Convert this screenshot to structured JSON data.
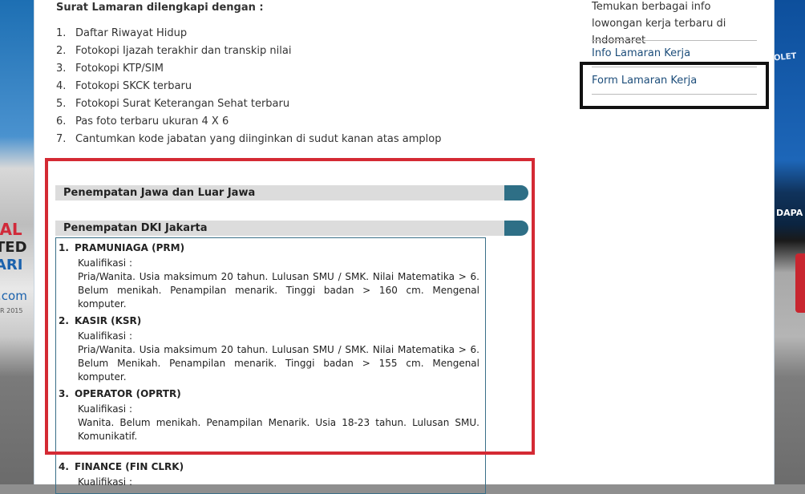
{
  "background": {
    "left_lines": [
      "IAL",
      "TED",
      "ARI",
      ".com",
      "R 2015"
    ],
    "right_lines": [
      "OLET",
      "DAPA"
    ]
  },
  "content": {
    "intro_title": "Surat Lamaran dilengkapi dengan :",
    "documents": [
      {
        "num": "1.",
        "text": "Daftar Riwayat Hidup"
      },
      {
        "num": "2.",
        "text": "Fotokopi Ijazah terakhir dan transkip nilai"
      },
      {
        "num": "3.",
        "text": "Fotokopi KTP/SIM"
      },
      {
        "num": "4.",
        "text": "Fotokopi SKCK terbaru"
      },
      {
        "num": "5.",
        "text": "Fotokopi Surat Keterangan Sehat terbaru"
      },
      {
        "num": "6.",
        "text": "Pas foto terbaru ukuran 4 X 6"
      },
      {
        "num": "7.",
        "text": "Cantumkan kode jabatan yang diinginkan di sudut kanan atas amplop"
      }
    ],
    "regions": [
      {
        "label": "Penempatan Jawa dan Luar Jawa"
      },
      {
        "label": "Penempatan DKI Jakarta"
      }
    ],
    "jobs": [
      {
        "num": "1.",
        "title": "PRAMUNIAGA (PRM)",
        "kualifikasi": "Kualifikasi :",
        "desc": "Pria/Wanita. Usia maksimum 20 tahun. Lulusan SMU / SMK. Nilai Matematika > 6. Belum menikah. Penampilan menarik. Tinggi badan > 160 cm. Mengenal komputer."
      },
      {
        "num": "2.",
        "title": "KASIR (KSR)",
        "kualifikasi": "Kualifikasi :",
        "desc": "Pria/Wanita. Usia maksimum 20 tahun. Lulusan SMU / SMK. Nilai Matematika > 6. Belum Menikah. Penampilan menarik. Tinggi badan > 155 cm. Mengenal komputer."
      },
      {
        "num": "3.",
        "title": "OPERATOR (OPRTR)",
        "kualifikasi": "Kualifikasi :",
        "desc": "Wanita. Belum menikah. Penampilan Menarik. Usia 18-23 tahun. Lulusan SMU. Komunikatif."
      },
      {
        "num": "4.",
        "title": "FINANCE (FIN CLRK)",
        "kualifikasi": "Kualifikasi :",
        "desc": ""
      }
    ]
  },
  "sidebar": {
    "intro": "Temukan berbagai info lowongan kerja terbaru di Indomaret",
    "links": [
      "Info Lamaran Kerja",
      "Form Lamaran Kerja"
    ]
  },
  "colors": {
    "highlight_red": "#d42a34",
    "highlight_black": "#111111",
    "bar_cap": "#2e6f86",
    "link": "#1c4d7a"
  }
}
